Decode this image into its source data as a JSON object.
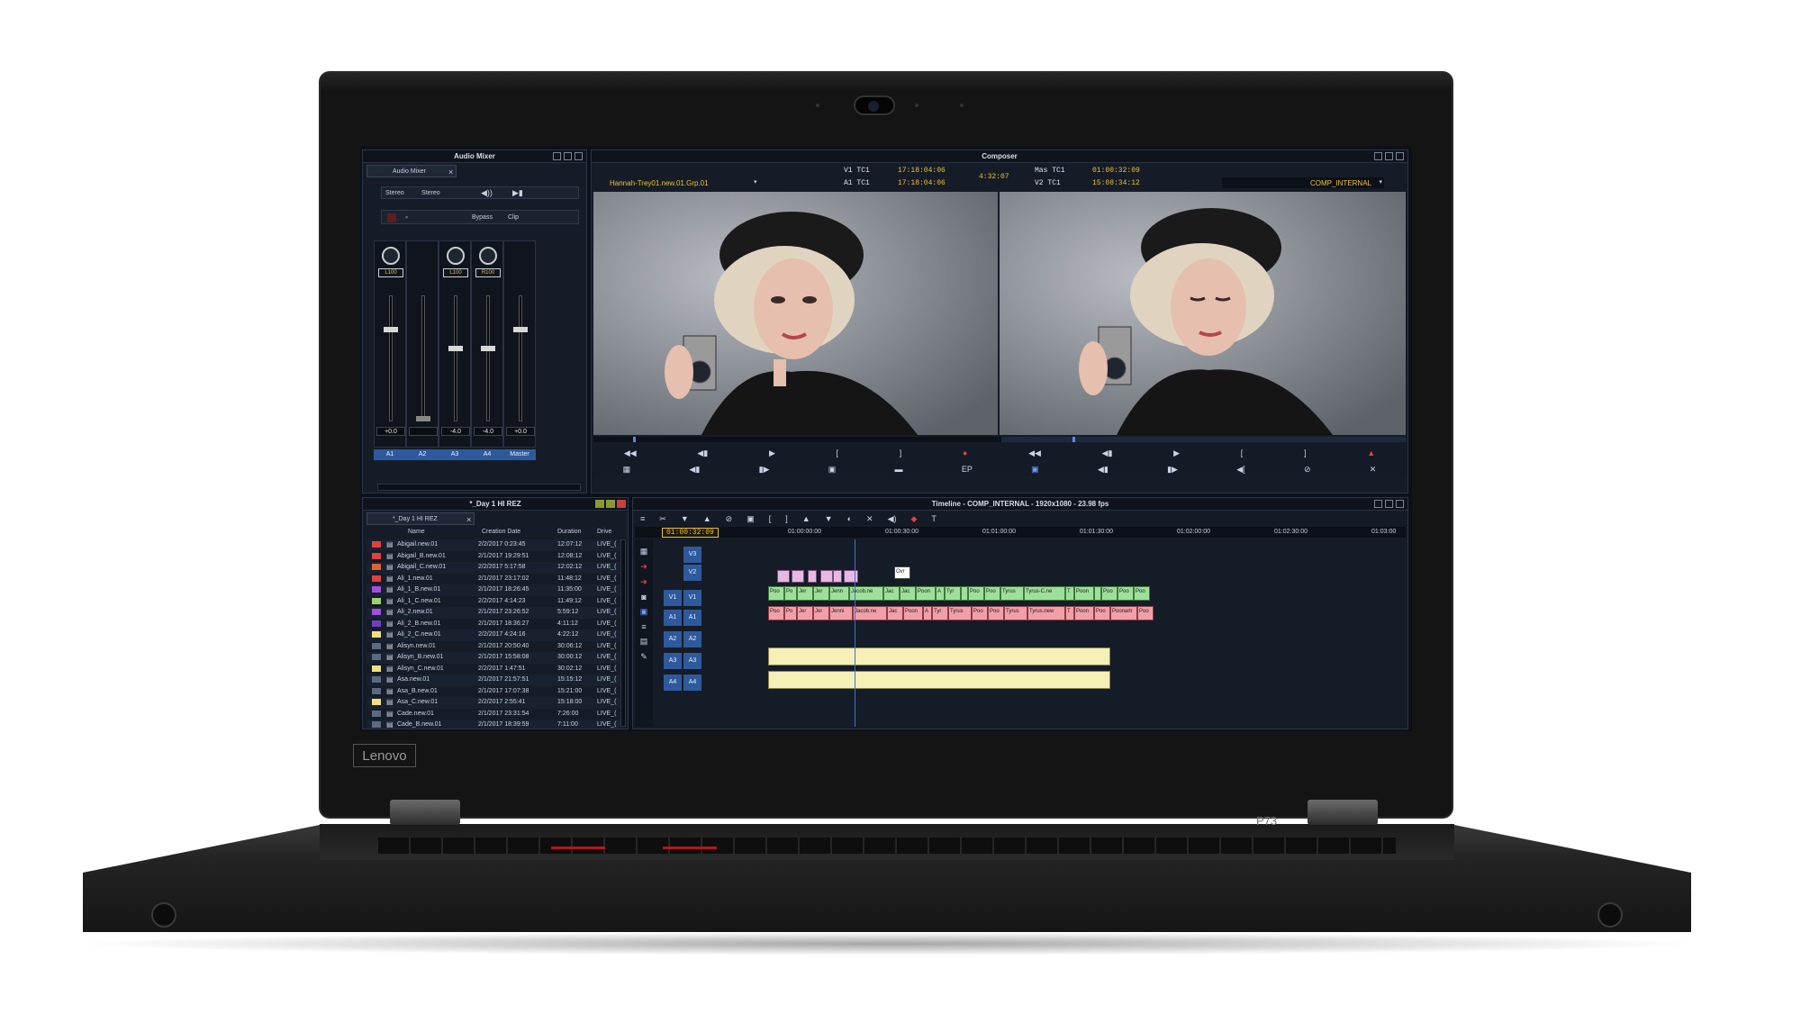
{
  "device": {
    "brand_badge": "Lenovo",
    "model": "P73",
    "accent_red": "#b01818"
  },
  "audio_mixer": {
    "title": "Audio Mixer",
    "tab_label": "Audio Mixer",
    "mode_left": "Stereo",
    "mode_right": "Stereo",
    "bypass_label": "Bypass",
    "clip_label": "Clip",
    "channels": [
      {
        "name": "A1",
        "knob": "L100",
        "fader": "+0.0",
        "level": 0.74
      },
      {
        "name": "A2",
        "knob": "",
        "fader": "",
        "level": 0.0
      },
      {
        "name": "A3",
        "knob": "L100",
        "fader": "-4.0",
        "level": 0.58
      },
      {
        "name": "A4",
        "knob": "R100",
        "fader": "-4.0",
        "level": 0.58
      },
      {
        "name": "Master",
        "knob": "",
        "fader": "+0.0",
        "level": 0.74
      }
    ]
  },
  "composer": {
    "title": "Composer",
    "clip_name": "Hannah-Trey01.new.01.Grp.01",
    "v1_label": "V1 TC1",
    "v1_tc": "17:18:04:06",
    "a1_label": "A1 TC1",
    "a1_tc": "17:18:04:06",
    "duration_tc": "4:32:07",
    "mas_label": "Mas TC1",
    "mas_tc": "01:00:32:09",
    "v2_label": "V2 TC1",
    "v2_tc": "15:08:34:12",
    "sequence_name": "COMP_INTERNAL",
    "ep_label": "EP"
  },
  "bin": {
    "title": "*_Day 1 HI REZ",
    "tab_label": "*_Day 1 HI REZ",
    "columns": [
      "Name",
      "Creation Date",
      "Duration",
      "Drive"
    ],
    "rows": [
      {
        "name": "Abigail.new.01",
        "date": "2/2/2017 0:23:45",
        "dur": "12:07:12",
        "drive": "LIVE_(",
        "color": "#e04040"
      },
      {
        "name": "Abigail_B.new.01",
        "date": "2/1/2017 19:29:51",
        "dur": "12:08:12",
        "drive": "LIVE_(",
        "color": "#e04040"
      },
      {
        "name": "Abigail_C.new.01",
        "date": "2/2/2017 5:17:58",
        "dur": "12:02:12",
        "drive": "LIVE_(",
        "color": "#e06030"
      },
      {
        "name": "Ali_1.new.01",
        "date": "2/1/2017 23:17:02",
        "dur": "11:48:12",
        "drive": "LIVE_(",
        "color": "#e04040"
      },
      {
        "name": "Ali_1_B.new.01",
        "date": "2/1/2017 18:26:45",
        "dur": "11:35:00",
        "drive": "LIVE_(",
        "color": "#a050e0"
      },
      {
        "name": "Ali_1_C.new.01",
        "date": "2/2/2017 4:14:23",
        "dur": "11:49:12",
        "drive": "LIVE_(",
        "color": "#9cd070"
      },
      {
        "name": "Ali_2.new.01",
        "date": "2/1/2017 23:26:52",
        "dur": "5:59:12",
        "drive": "LIVE_(",
        "color": "#a050e0"
      },
      {
        "name": "Ali_2_B.new.01",
        "date": "2/1/2017 18:36:27",
        "dur": "4:11:12",
        "drive": "LIVE_(",
        "color": "#7040c0"
      },
      {
        "name": "Ali_2_C.new.01",
        "date": "2/2/2017 4:24:16",
        "dur": "4:22:12",
        "drive": "LIVE_(",
        "color": "#f0e080"
      },
      {
        "name": "Alisyn.new.01",
        "date": "2/1/2017 20:50:40",
        "dur": "30:06:12",
        "drive": "LIVE_(",
        "color": "#5a6a80"
      },
      {
        "name": "Alisyn_B.new.01",
        "date": "2/1/2017 15:58:08",
        "dur": "30:00:12",
        "drive": "LIVE_(",
        "color": "#5a6a80"
      },
      {
        "name": "Alisyn_C.new.01",
        "date": "2/2/2017 1:47:51",
        "dur": "30:02:12",
        "drive": "LIVE_(",
        "color": "#f0e080"
      },
      {
        "name": "Asa.new.01",
        "date": "2/1/2017 21:57:51",
        "dur": "15:15:12",
        "drive": "LIVE_(",
        "color": "#5a6a80"
      },
      {
        "name": "Asa_B.new.01",
        "date": "2/1/2017 17:07:38",
        "dur": "15:21:00",
        "drive": "LIVE_(",
        "color": "#5a6a80"
      },
      {
        "name": "Asa_C.new.01",
        "date": "2/2/2017 2:55:41",
        "dur": "15:18:00",
        "drive": "LIVE_(",
        "color": "#f0e080"
      },
      {
        "name": "Cade.new.01",
        "date": "2/1/2017 23:31:54",
        "dur": "7:26:00",
        "drive": "LIVE_(",
        "color": "#5a6a80"
      },
      {
        "name": "Cade_B.new.01",
        "date": "2/1/2017 18:39:59",
        "dur": "7:11:00",
        "drive": "LIVE_(",
        "color": "#5a6a80"
      }
    ]
  },
  "timeline": {
    "title": "Timeline - COMP_INTERNAL - 1920x1080 - 23.98 fps",
    "position_tc": "01:00:32:09",
    "ruler": [
      "01:00:00:00",
      "01:00:30:00",
      "01:01:00:00",
      "01:01:30:00",
      "01:02:00:00",
      "01:02:30:00",
      "01:03:00"
    ],
    "tracks": [
      "V3",
      "V2",
      "V1",
      "A1",
      "A2",
      "A3",
      "A4"
    ],
    "source_tracks": [
      "V1",
      "A1",
      "A2",
      "A3",
      "A4"
    ],
    "v1_clips": [
      "Poo",
      "Po",
      "Jer",
      "Jer",
      "Jenn",
      "Jacob.ne",
      "Jac",
      "Jac",
      "Poon",
      "A",
      "Tyr",
      "",
      "Poo",
      "Poo",
      "Tyrus",
      "Tyrus-C.ne",
      "T",
      "Poon",
      "",
      "Poo",
      "Poo",
      "Poo"
    ],
    "a1_clips": [
      "Poo",
      "Po",
      "Jer",
      "Jer",
      "Jenni",
      "Jacob.ne",
      "Jac",
      "Poon",
      "A",
      "Tyr",
      "Tyrus",
      "Poo",
      "Poo",
      "Tyrus",
      "Tyrus.new",
      "T",
      "Poon",
      "Poo",
      "Poonam",
      "Poo"
    ],
    "v2_label": "Ovr"
  },
  "colors": {
    "accent_blue": "#2e5a9c",
    "timecode_yellow": "#f0c030",
    "clip_green": "#9ee09a",
    "clip_pink": "#f2a0a8",
    "clip_yellow": "#f4f0b8"
  }
}
